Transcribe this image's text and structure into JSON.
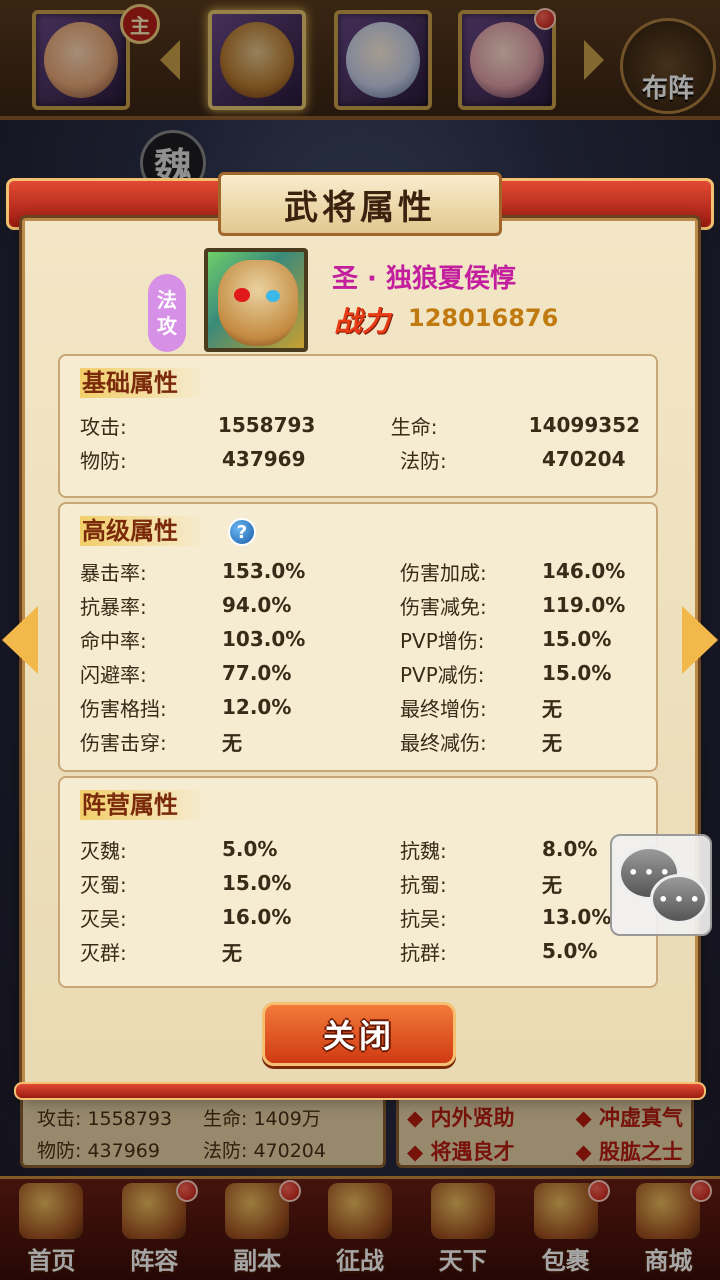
{
  "top_bar": {
    "lord_badge": "主",
    "formation_label": "布阵",
    "faction_seal": "魏"
  },
  "panel": {
    "title": "武将属性",
    "hero": {
      "type_badge": [
        "法",
        "攻"
      ],
      "name": "圣 · 独狼夏侯惇",
      "power_label": "战力",
      "power_value": "128016876"
    },
    "basic": {
      "title": "基础属性",
      "rows": [
        {
          "l1": "攻击:",
          "v1": "1558793",
          "l2": "生命:",
          "v2": "14099352"
        },
        {
          "l1": "物防:",
          "v1": "437969",
          "l2": "法防:",
          "v2": "470204"
        }
      ]
    },
    "advanced": {
      "title": "高级属性",
      "help": "?",
      "rows": [
        {
          "l1": "暴击率:",
          "v1": "153.0%",
          "l2": "伤害加成:",
          "v2": "146.0%"
        },
        {
          "l1": "抗暴率:",
          "v1": "94.0%",
          "l2": "伤害减免:",
          "v2": "119.0%"
        },
        {
          "l1": "命中率:",
          "v1": "103.0%",
          "l2": "PVP增伤:",
          "v2": "15.0%"
        },
        {
          "l1": "闪避率:",
          "v1": "77.0%",
          "l2": "PVP减伤:",
          "v2": "15.0%"
        },
        {
          "l1": "伤害格挡:",
          "v1": "12.0%",
          "l2": "最终增伤:",
          "v2": "无"
        },
        {
          "l1": "伤害击穿:",
          "v1": "无",
          "l2": "最终减伤:",
          "v2": "无"
        }
      ]
    },
    "faction": {
      "title": "阵营属性",
      "rows": [
        {
          "l1": "灭魏:",
          "v1": "5.0%",
          "l2": "抗魏:",
          "v2": "8.0%"
        },
        {
          "l1": "灭蜀:",
          "v1": "15.0%",
          "l2": "抗蜀:",
          "v2": "无"
        },
        {
          "l1": "灭吴:",
          "v1": "16.0%",
          "l2": "抗吴:",
          "v2": "13.0%"
        },
        {
          "l1": "灭群:",
          "v1": "无",
          "l2": "抗群:",
          "v2": "5.0%"
        }
      ]
    },
    "close_label": "关闭"
  },
  "bg_stats": {
    "atk": "攻击: 1558793",
    "hp": "生命: 1409万",
    "pdef": "物防: 437969",
    "mdef": "法防: 470204"
  },
  "bg_skills": [
    "◆ 内外贤助",
    "◆ 冲虚真气",
    "◆ 将遇良才",
    "◆ 股肱之士"
  ],
  "bottom_nav": [
    {
      "label": "首页",
      "icon": "home-icon"
    },
    {
      "label": "阵容",
      "icon": "lineup-icon"
    },
    {
      "label": "副本",
      "icon": "dungeon-icon"
    },
    {
      "label": "征战",
      "icon": "campaign-icon"
    },
    {
      "label": "天下",
      "icon": "world-icon"
    },
    {
      "label": "包裹",
      "icon": "bag-icon"
    },
    {
      "label": "商城",
      "icon": "shop-icon"
    }
  ],
  "colors": {
    "accent_red": "#d03a12",
    "gold": "#f2b84a",
    "hero_name": "#c21e9e",
    "power_value": "#c07a10"
  }
}
